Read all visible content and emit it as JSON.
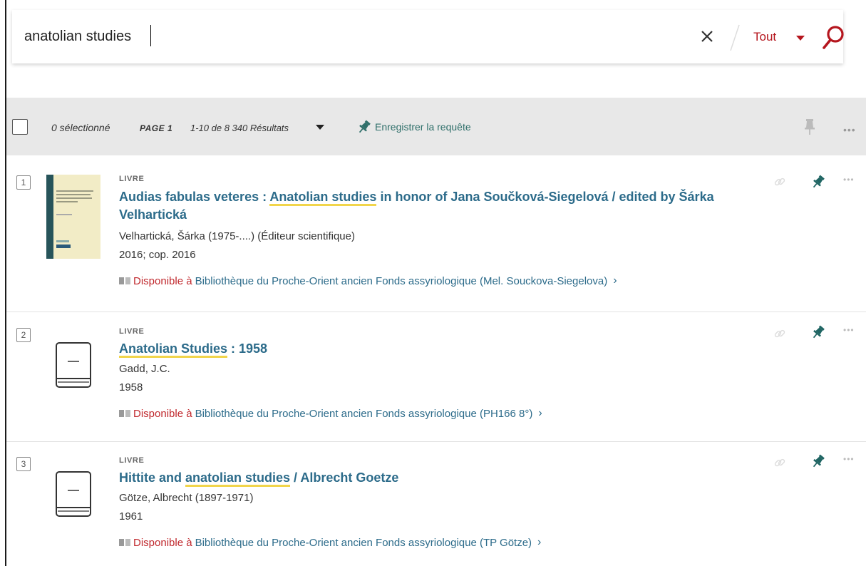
{
  "search": {
    "query": "anatolian studies",
    "scope": "Tout"
  },
  "toolbar": {
    "selected": "0 sélectionné",
    "page": "PAGE 1",
    "results": "1-10 de 8 340 Résultats",
    "save_query": "Enregistrer la requête"
  },
  "results": [
    {
      "index": "1",
      "type": "LIVRE",
      "title_pre": "Audias fabulas veteres : ",
      "title_hl": "Anatolian studies",
      "title_post": " in honor of Jana Součková-Siegelová / edited by Šárka Velhartická",
      "author": "Velhartická, Šárka (1975-....) (Éditeur scientifique)",
      "date": "2016; cop. 2016",
      "status": "Disponible à",
      "location": "Bibliothèque du Proche-Orient ancien  Fonds assyriologique (Mel. Souckova-Siegelova)",
      "cover": "book-cover-image"
    },
    {
      "index": "2",
      "type": "LIVRE",
      "title_pre": "",
      "title_hl": "Anatolian Studies",
      "title_post": " : 1958",
      "author": "Gadd, J.C.",
      "date": "1958",
      "status": "Disponible à",
      "location": "Bibliothèque du Proche-Orient ancien  Fonds assyriologique (PH166 8°)",
      "cover": "book-icon"
    },
    {
      "index": "3",
      "type": "LIVRE",
      "title_pre": "Hittite and ",
      "title_hl": "anatolian studies",
      "title_post": " / Albrecht Goetze",
      "author": "Götze, Albrecht (1897-1971)",
      "date": "1961",
      "status": "Disponible à",
      "location": "Bibliothèque du Proche-Orient ancien  Fonds assyriologique (TP Götze)",
      "cover": "book-icon"
    }
  ],
  "icons": {
    "clear": "close-icon",
    "scope_arrow": "caret-down-icon",
    "search": "search-icon",
    "pin": "pin-icon",
    "link": "link-icon",
    "more": "more-icon",
    "availability": "book-open-icon"
  },
  "colors": {
    "accent_red": "#b5161e",
    "teal": "#2f6f6a",
    "link_blue": "#2c6b8a",
    "highlight": "#f1d54b",
    "toolbar_bg": "#e8e8e8"
  }
}
